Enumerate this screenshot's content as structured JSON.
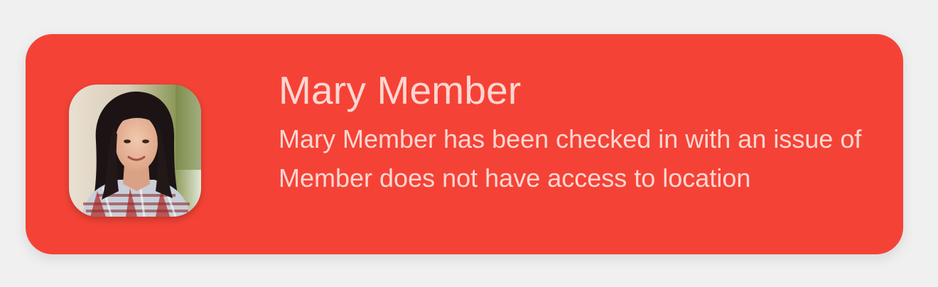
{
  "notification": {
    "title": "Mary Member",
    "message": "Mary Member has been checked in with an issue of Member does not have access to location",
    "avatar_icon": "member-photo",
    "background_color": "#f44336",
    "text_color": "#ffd6d2"
  }
}
